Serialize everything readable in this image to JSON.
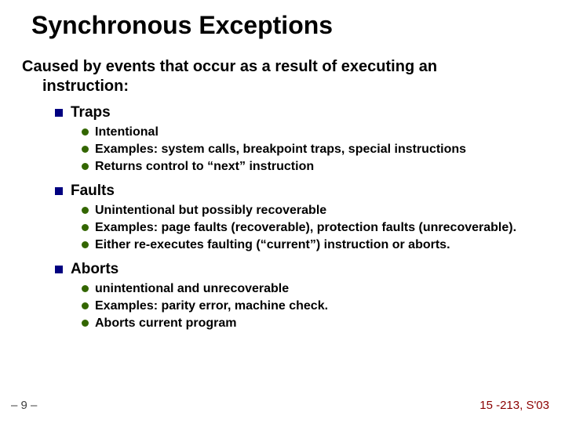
{
  "title": "Synchronous Exceptions",
  "lead_line1": "Caused by events that occur as a result of executing an",
  "lead_line2": "instruction:",
  "sections": [
    {
      "heading": "Traps",
      "items": [
        "Intentional",
        "Examples: system calls, breakpoint traps, special instructions",
        "Returns control to “next” instruction"
      ]
    },
    {
      "heading": "Faults",
      "items": [
        "Unintentional but possibly recoverable",
        "Examples: page faults (recoverable), protection faults (unrecoverable).",
        "Either re-executes faulting (“current”) instruction or aborts."
      ]
    },
    {
      "heading": "Aborts",
      "items": [
        "unintentional and unrecoverable",
        "Examples: parity error, machine check.",
        "Aborts current program"
      ]
    }
  ],
  "footer": {
    "left": "– 9 –",
    "right": "15 -213, S'03"
  }
}
